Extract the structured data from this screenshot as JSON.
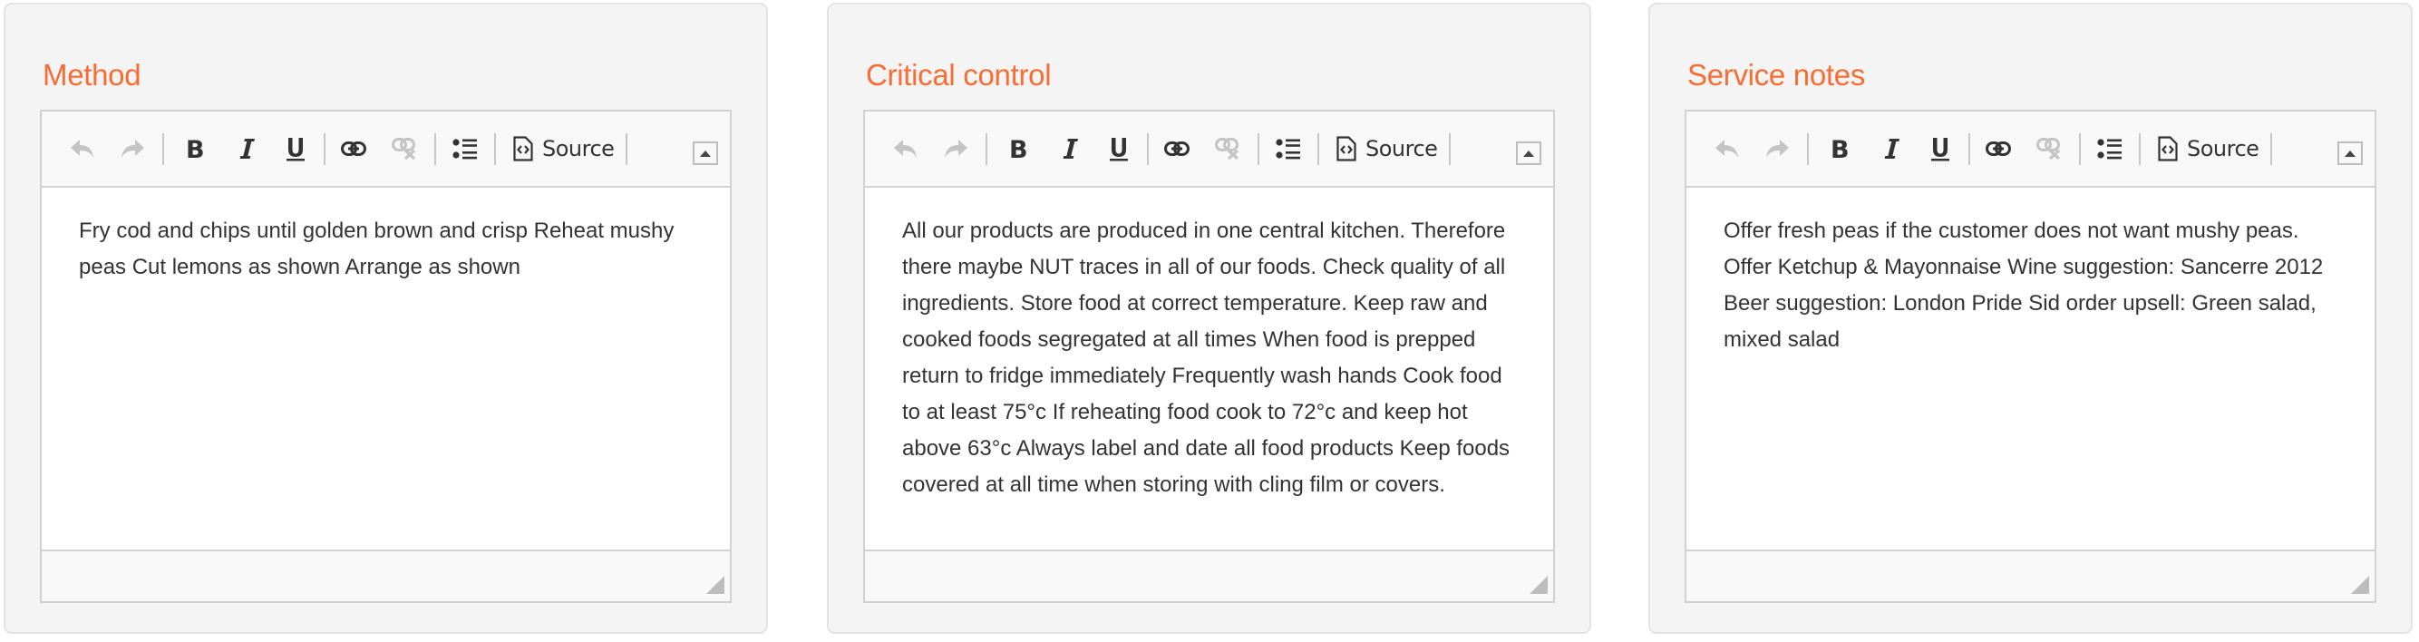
{
  "theme": {
    "accent": "#f96c33",
    "text": "#333333",
    "disabled_icon": "#c4c4c4"
  },
  "toolbar": {
    "undo_icon": "undo-icon",
    "redo_icon": "redo-icon",
    "bold_icon": "bold-icon",
    "italic_icon": "italic-icon",
    "underline_icon": "underline-icon",
    "link_icon": "link-icon",
    "unlink_icon": "unlink-icon",
    "bulleted_list_icon": "bulleted-list-icon",
    "source_icon": "source-code-icon",
    "source_label": "Source",
    "collapse_icon": "collapse-toolbar-icon"
  },
  "panels": [
    {
      "title": "Method",
      "content": "Fry cod and chips until golden brown and crisp Reheat mushy peas Cut lemons as shown Arrange as shown"
    },
    {
      "title": "Critical control",
      "content": "All our products are produced in one central kitchen. Therefore there maybe NUT traces in all of our foods. Check quality of all ingredients. Store food at correct temperature. Keep raw and cooked foods segregated at all times When food is prepped return to fridge immediately Frequently wash hands Cook food to at least 75°c If reheating food cook to 72°c and keep hot above 63°c Always label and date all food products Keep foods covered at all time when storing with cling film or covers."
    },
    {
      "title": "Service notes",
      "content": "Offer fresh peas if the customer does not want mushy peas. Offer Ketchup & Mayonnaise Wine suggestion: Sancerre 2012 Beer suggestion: London Pride Sid order upsell: Green salad, mixed salad"
    }
  ]
}
